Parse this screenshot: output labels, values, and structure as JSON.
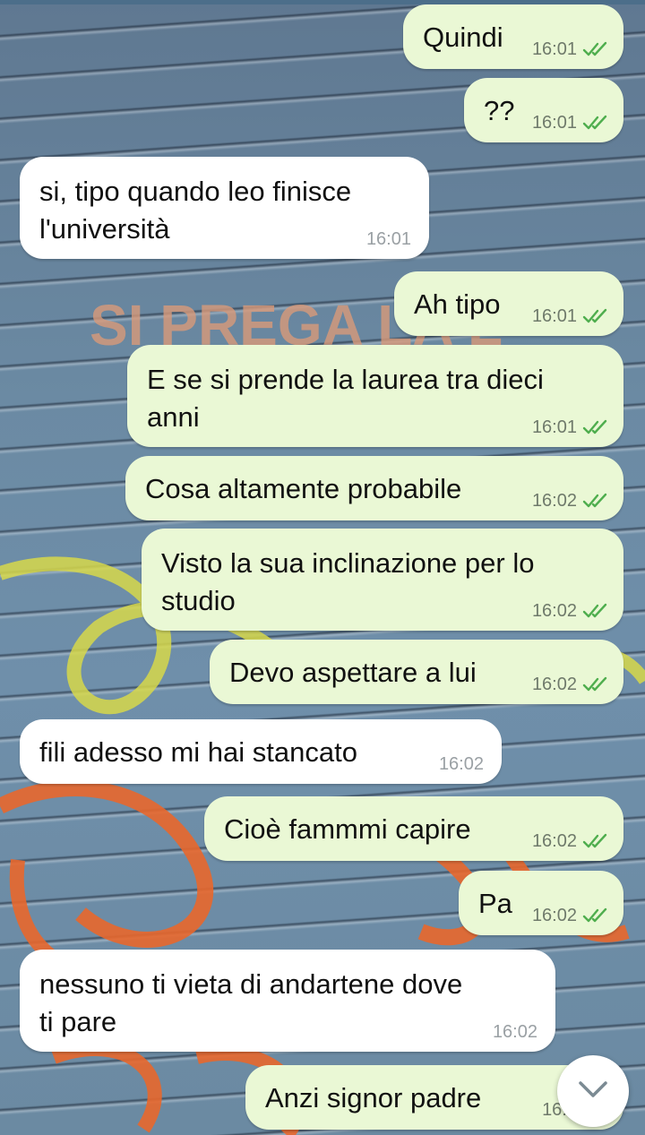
{
  "messages": [
    {
      "dir": "out",
      "lines": [
        "Quindi"
      ],
      "time": "16:01"
    },
    {
      "dir": "out",
      "lines": [
        "??"
      ],
      "time": "16:01"
    },
    {
      "dir": "in",
      "lines": [
        "si, tipo quando leo finisce",
        "l'università"
      ],
      "time": "16:01"
    },
    {
      "dir": "out",
      "lines": [
        "Ah tipo"
      ],
      "time": "16:01"
    },
    {
      "dir": "out",
      "lines": [
        "E se si prende la laurea tra dieci",
        "anni"
      ],
      "time": "16:01"
    },
    {
      "dir": "out",
      "lines": [
        "Cosa altamente probabile"
      ],
      "time": "16:02"
    },
    {
      "dir": "out",
      "lines": [
        "Visto la sua inclinazione per lo",
        "studio"
      ],
      "time": "16:02"
    },
    {
      "dir": "out",
      "lines": [
        "Devo aspettare a lui"
      ],
      "time": "16:02"
    },
    {
      "dir": "in",
      "lines": [
        "fili adesso mi hai stancato"
      ],
      "time": "16:02"
    },
    {
      "dir": "out",
      "lines": [
        "Cioè fammmi capire"
      ],
      "time": "16:02"
    },
    {
      "dir": "out",
      "lines": [
        "Pa"
      ],
      "time": "16:02"
    },
    {
      "dir": "in",
      "lines": [
        "nessuno ti vieta di andartene dove",
        "ti pare"
      ],
      "time": "16:02"
    },
    {
      "dir": "out",
      "lines": [
        "Anzi signor padre"
      ],
      "time": "16:0"
    }
  ],
  "wallpaper": {
    "graffiti_text": "SI PREGA LA L"
  },
  "colors": {
    "outgoing_bubble": "#eaf8d5",
    "incoming_bubble": "#ffffff",
    "read_ticks": "#4fae4e"
  },
  "icons": {
    "read_receipt": "double-check-icon",
    "scroll_down": "chevron-down-icon"
  }
}
